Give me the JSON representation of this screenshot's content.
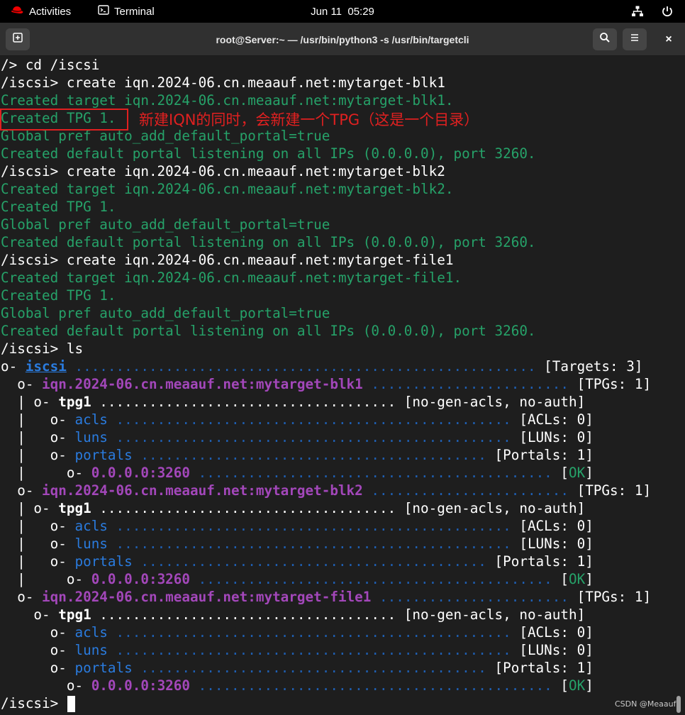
{
  "topbar": {
    "activities": "Activities",
    "app": "Terminal",
    "clock": "Jun 11  05:29"
  },
  "window": {
    "title": "root@Server:~ — /usr/bin/python3 -s /usr/bin/targetcli",
    "close": "×"
  },
  "colors": {
    "terminal_bg": "#1e1e1e",
    "green": "#26a269",
    "cyan": "#2a7bde",
    "purple": "#a347ba",
    "dots": "#1f5fb3",
    "annotation": "#e02020"
  },
  "annotation": {
    "text": "新建IQN的同时，会新建一个TPG（这是一个目录）"
  },
  "terminal": {
    "lines": [
      [
        {
          "t": "/> cd /iscsi"
        }
      ],
      [
        {
          "t": "/iscsi> create iqn.2024-06.cn.meaauf.net:mytarget-blk1"
        }
      ],
      [
        {
          "t": "Created target iqn.2024-06.cn.meaauf.net:mytarget-blk1.",
          "c": "g"
        }
      ],
      [
        {
          "t": "Created TPG 1.",
          "c": "g"
        }
      ],
      [
        {
          "t": "Global pref auto_add_default_portal=true",
          "c": "g"
        }
      ],
      [
        {
          "t": "Created default portal listening on all IPs (0.0.0.0), port 3260.",
          "c": "g"
        }
      ],
      [
        {
          "t": "/iscsi> create iqn.2024-06.cn.meaauf.net:mytarget-blk2"
        }
      ],
      [
        {
          "t": "Created target iqn.2024-06.cn.meaauf.net:mytarget-blk2.",
          "c": "g"
        }
      ],
      [
        {
          "t": "Created TPG 1.",
          "c": "g"
        }
      ],
      [
        {
          "t": "Global pref auto_add_default_portal=true",
          "c": "g"
        }
      ],
      [
        {
          "t": "Created default portal listening on all IPs (0.0.0.0), port 3260.",
          "c": "g"
        }
      ],
      [
        {
          "t": "/iscsi> create iqn.2024-06.cn.meaauf.net:mytarget-file1"
        }
      ],
      [
        {
          "t": "Created target iqn.2024-06.cn.meaauf.net:mytarget-file1.",
          "c": "g"
        }
      ],
      [
        {
          "t": "Created TPG 1.",
          "c": "g"
        }
      ],
      [
        {
          "t": "Global pref auto_add_default_portal=true",
          "c": "g"
        }
      ],
      [
        {
          "t": "Created default portal listening on all IPs (0.0.0.0), port 3260.",
          "c": "g"
        }
      ],
      [
        {
          "t": "/iscsi> ls"
        }
      ],
      [
        {
          "t": "o- "
        },
        {
          "t": "iscsi",
          "c": "cy-u"
        },
        {
          "t": " ........................................................ ",
          "c": "bl"
        },
        {
          "t": "[Targets: 3]"
        }
      ],
      [
        {
          "t": "  o- "
        },
        {
          "t": "iqn.2024-06.cn.meaauf.net:mytarget-blk1",
          "c": "pur"
        },
        {
          "t": " ........................ ",
          "c": "bl"
        },
        {
          "t": "[TPGs: 1]"
        }
      ],
      [
        {
          "t": "  | o- "
        },
        {
          "t": "tpg1",
          "c": "b"
        },
        {
          "t": " .................................... "
        },
        {
          "t": "[no-gen-acls, no-auth]"
        }
      ],
      [
        {
          "t": "  |   o- "
        },
        {
          "t": "acls",
          "c": "cy"
        },
        {
          "t": " ................................................ ",
          "c": "bl"
        },
        {
          "t": "[ACLs: 0]"
        }
      ],
      [
        {
          "t": "  |   o- "
        },
        {
          "t": "luns",
          "c": "cy"
        },
        {
          "t": " ................................................ ",
          "c": "bl"
        },
        {
          "t": "[LUNs: 0]"
        }
      ],
      [
        {
          "t": "  |   o- "
        },
        {
          "t": "portals",
          "c": "cy"
        },
        {
          "t": " .......................................... ",
          "c": "bl"
        },
        {
          "t": "[Portals: 1]"
        }
      ],
      [
        {
          "t": "  |     o- "
        },
        {
          "t": "0.0.0.0:3260",
          "c": "pur"
        },
        {
          "t": " ........................................... ",
          "c": "bl"
        },
        {
          "t": "["
        },
        {
          "t": "OK",
          "c": "okc"
        },
        {
          "t": "]"
        }
      ],
      [
        {
          "t": "  o- "
        },
        {
          "t": "iqn.2024-06.cn.meaauf.net:mytarget-blk2",
          "c": "pur"
        },
        {
          "t": " ........................ ",
          "c": "bl"
        },
        {
          "t": "[TPGs: 1]"
        }
      ],
      [
        {
          "t": "  | o- "
        },
        {
          "t": "tpg1",
          "c": "b"
        },
        {
          "t": " .................................... "
        },
        {
          "t": "[no-gen-acls, no-auth]"
        }
      ],
      [
        {
          "t": "  |   o- "
        },
        {
          "t": "acls",
          "c": "cy"
        },
        {
          "t": " ................................................ ",
          "c": "bl"
        },
        {
          "t": "[ACLs: 0]"
        }
      ],
      [
        {
          "t": "  |   o- "
        },
        {
          "t": "luns",
          "c": "cy"
        },
        {
          "t": " ................................................ ",
          "c": "bl"
        },
        {
          "t": "[LUNs: 0]"
        }
      ],
      [
        {
          "t": "  |   o- "
        },
        {
          "t": "portals",
          "c": "cy"
        },
        {
          "t": " .......................................... ",
          "c": "bl"
        },
        {
          "t": "[Portals: 1]"
        }
      ],
      [
        {
          "t": "  |     o- "
        },
        {
          "t": "0.0.0.0:3260",
          "c": "pur"
        },
        {
          "t": " ........................................... ",
          "c": "bl"
        },
        {
          "t": "["
        },
        {
          "t": "OK",
          "c": "okc"
        },
        {
          "t": "]"
        }
      ],
      [
        {
          "t": "  o- "
        },
        {
          "t": "iqn.2024-06.cn.meaauf.net:mytarget-file1",
          "c": "pur"
        },
        {
          "t": " ....................... ",
          "c": "bl"
        },
        {
          "t": "[TPGs: 1]"
        }
      ],
      [
        {
          "t": "    o- "
        },
        {
          "t": "tpg1",
          "c": "b"
        },
        {
          "t": " .................................... "
        },
        {
          "t": "[no-gen-acls, no-auth]"
        }
      ],
      [
        {
          "t": "      o- "
        },
        {
          "t": "acls",
          "c": "cy"
        },
        {
          "t": " ................................................ ",
          "c": "bl"
        },
        {
          "t": "[ACLs: 0]"
        }
      ],
      [
        {
          "t": "      o- "
        },
        {
          "t": "luns",
          "c": "cy"
        },
        {
          "t": " ................................................ ",
          "c": "bl"
        },
        {
          "t": "[LUNs: 0]"
        }
      ],
      [
        {
          "t": "      o- "
        },
        {
          "t": "portals",
          "c": "cy"
        },
        {
          "t": " .......................................... ",
          "c": "bl"
        },
        {
          "t": "[Portals: 1]"
        }
      ],
      [
        {
          "t": "        o- "
        },
        {
          "t": "0.0.0.0:3260",
          "c": "pur"
        },
        {
          "t": " ........................................... ",
          "c": "bl"
        },
        {
          "t": "["
        },
        {
          "t": "OK",
          "c": "okc"
        },
        {
          "t": "]"
        }
      ]
    ],
    "prompt": "/iscsi> "
  },
  "watermark": "CSDN @Meaauf"
}
